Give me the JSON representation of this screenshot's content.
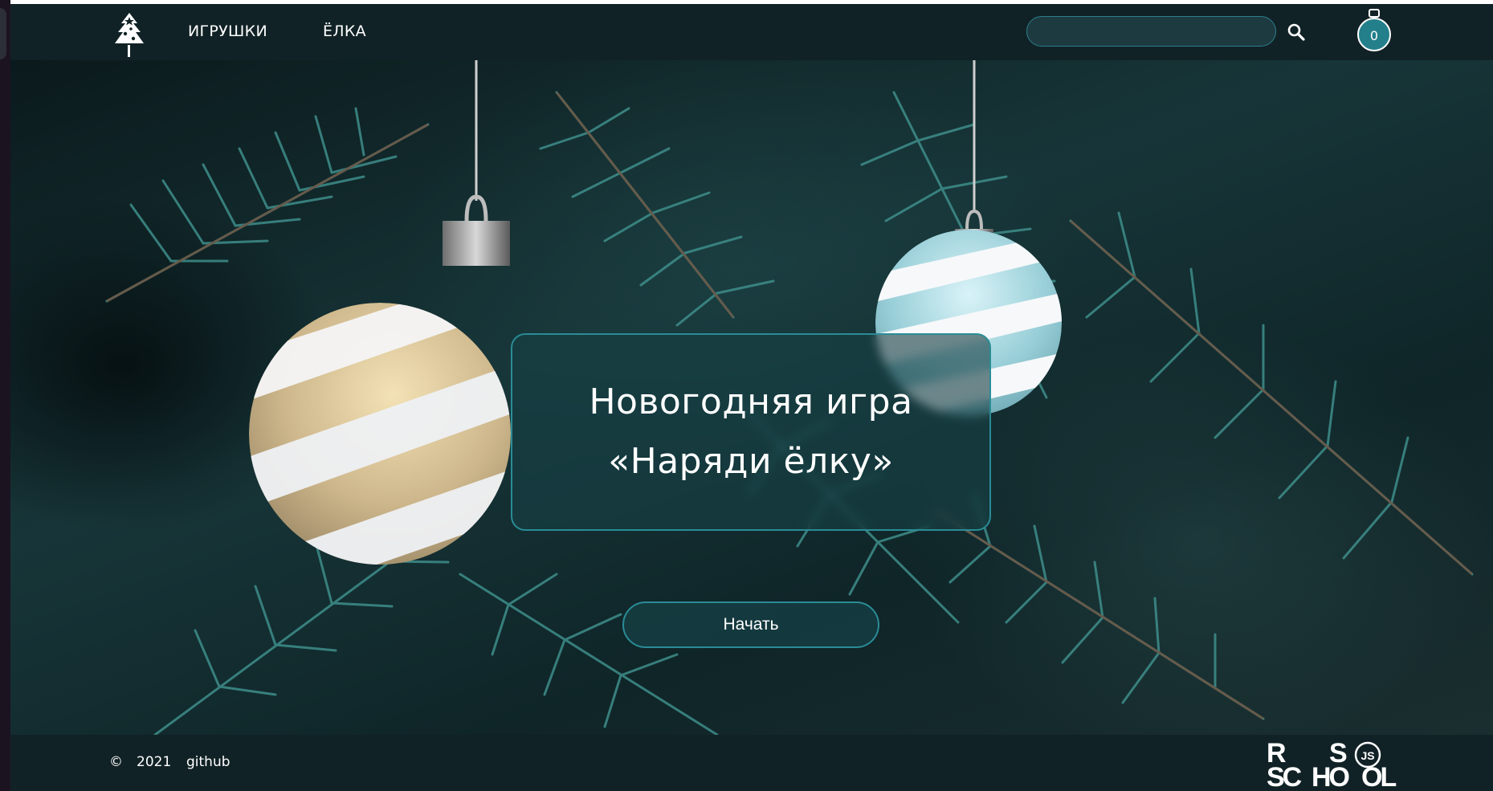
{
  "header": {
    "nav": [
      {
        "label": "ИГРУШКИ"
      },
      {
        "label": "ЁЛКА"
      }
    ],
    "search": {
      "placeholder": "",
      "value": ""
    },
    "cart": {
      "count": "0"
    }
  },
  "hero": {
    "title_line1": "Новогодняя игра",
    "title_line2": "«Наряди ёлку»",
    "start_button": "Начать"
  },
  "footer": {
    "copyright_symbol": "©",
    "year": "2021",
    "github": "github",
    "school_logo_text": "RS SCHOOL JS"
  },
  "colors": {
    "header_bg": "#112226",
    "accent": "#2a8c96",
    "cart_badge": "#23808b",
    "glass": "#164046"
  },
  "icons": [
    "tree-logo-icon",
    "search-icon",
    "cart-icon",
    "rs-school-logo"
  ]
}
